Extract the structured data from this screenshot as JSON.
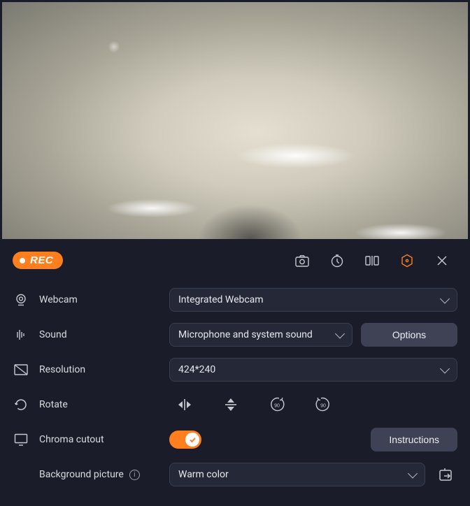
{
  "toolbar": {
    "rec_label": "REC"
  },
  "rows": {
    "webcam": {
      "label": "Webcam",
      "value": "Integrated Webcam"
    },
    "sound": {
      "label": "Sound",
      "value": "Microphone and system sound",
      "options_label": "Options"
    },
    "resolution": {
      "label": "Resolution",
      "value": "424*240"
    },
    "rotate": {
      "label": "Rotate"
    },
    "chroma": {
      "label": "Chroma cutout",
      "instructions_label": "Instructions"
    },
    "background": {
      "label": "Background picture",
      "value": "Warm color"
    }
  }
}
